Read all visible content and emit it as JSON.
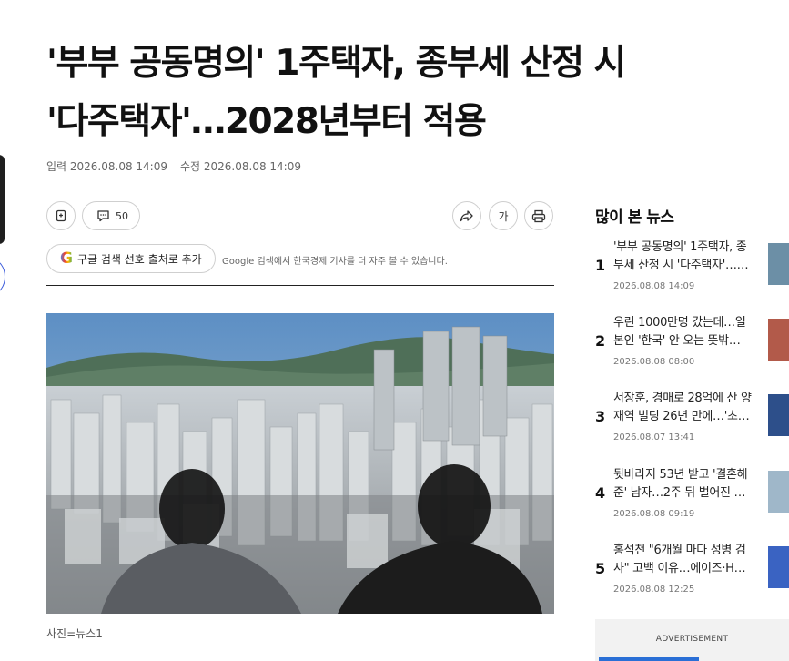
{
  "article": {
    "title_line1": "'부부 공동명의' 1주택자, 종부세 산정 시",
    "title_line2": "'다주택자'…2028년부터 적용",
    "published": "입력 2026.08.08 14:09",
    "modified": "수정 2026.08.08 14:09",
    "comment_count": "50",
    "font_button_label": "가",
    "google_button_label": "구글 검색 선호 출처로 추가",
    "google_logo": "G",
    "google_description": "Google 검색에서 한국경제 기사를 더 자주 볼 수 있습니다.",
    "photo_caption": "사진=뉴스1"
  },
  "icons": {
    "bookmark": "bookmark-icon",
    "comment": "comment-icon",
    "share": "share-icon",
    "print": "print-icon"
  },
  "sidebar": {
    "title": "많이 본 뉴스",
    "items": [
      {
        "rank": "1",
        "line1": "'부부 공동명의' 1주택자, 종",
        "line2": "부세 산정 시 '다주택자'……",
        "date": "2026.08.08 14:09",
        "thumb_color": "#6c8fa6"
      },
      {
        "rank": "2",
        "line1": "우린 1000만명 갔는데…일",
        "line2": "본인 '한국' 안 오는 뜻밖…",
        "date": "2026.08.08 08:00",
        "thumb_color": "#b25a4a"
      },
      {
        "rank": "3",
        "line1": "서장훈, 경매로 28억에 산 양",
        "line2": "재역 빌딩 26년 만에…'초…",
        "date": "2026.08.07 13:41",
        "thumb_color": "#2d4f8a"
      },
      {
        "rank": "4",
        "line1": "뒷바라지 53년 받고 '결혼해",
        "line2": "준' 남자…2주 뒤 벌어진 …",
        "date": "2026.08.08 09:19",
        "thumb_color": "#9fb7c9"
      },
      {
        "rank": "5",
        "line1": "홍석천 \"6개월 마다 성병 검",
        "line2": "사\" 고백 이유…에이즈·H…",
        "date": "2026.08.08 12:25",
        "thumb_color": "#3a63c2"
      }
    ]
  },
  "ad": {
    "label": "ADVERTISEMENT"
  },
  "colors": {
    "accent": "#111111",
    "rule": "#222222",
    "ad_background": "#f2f2f2"
  }
}
